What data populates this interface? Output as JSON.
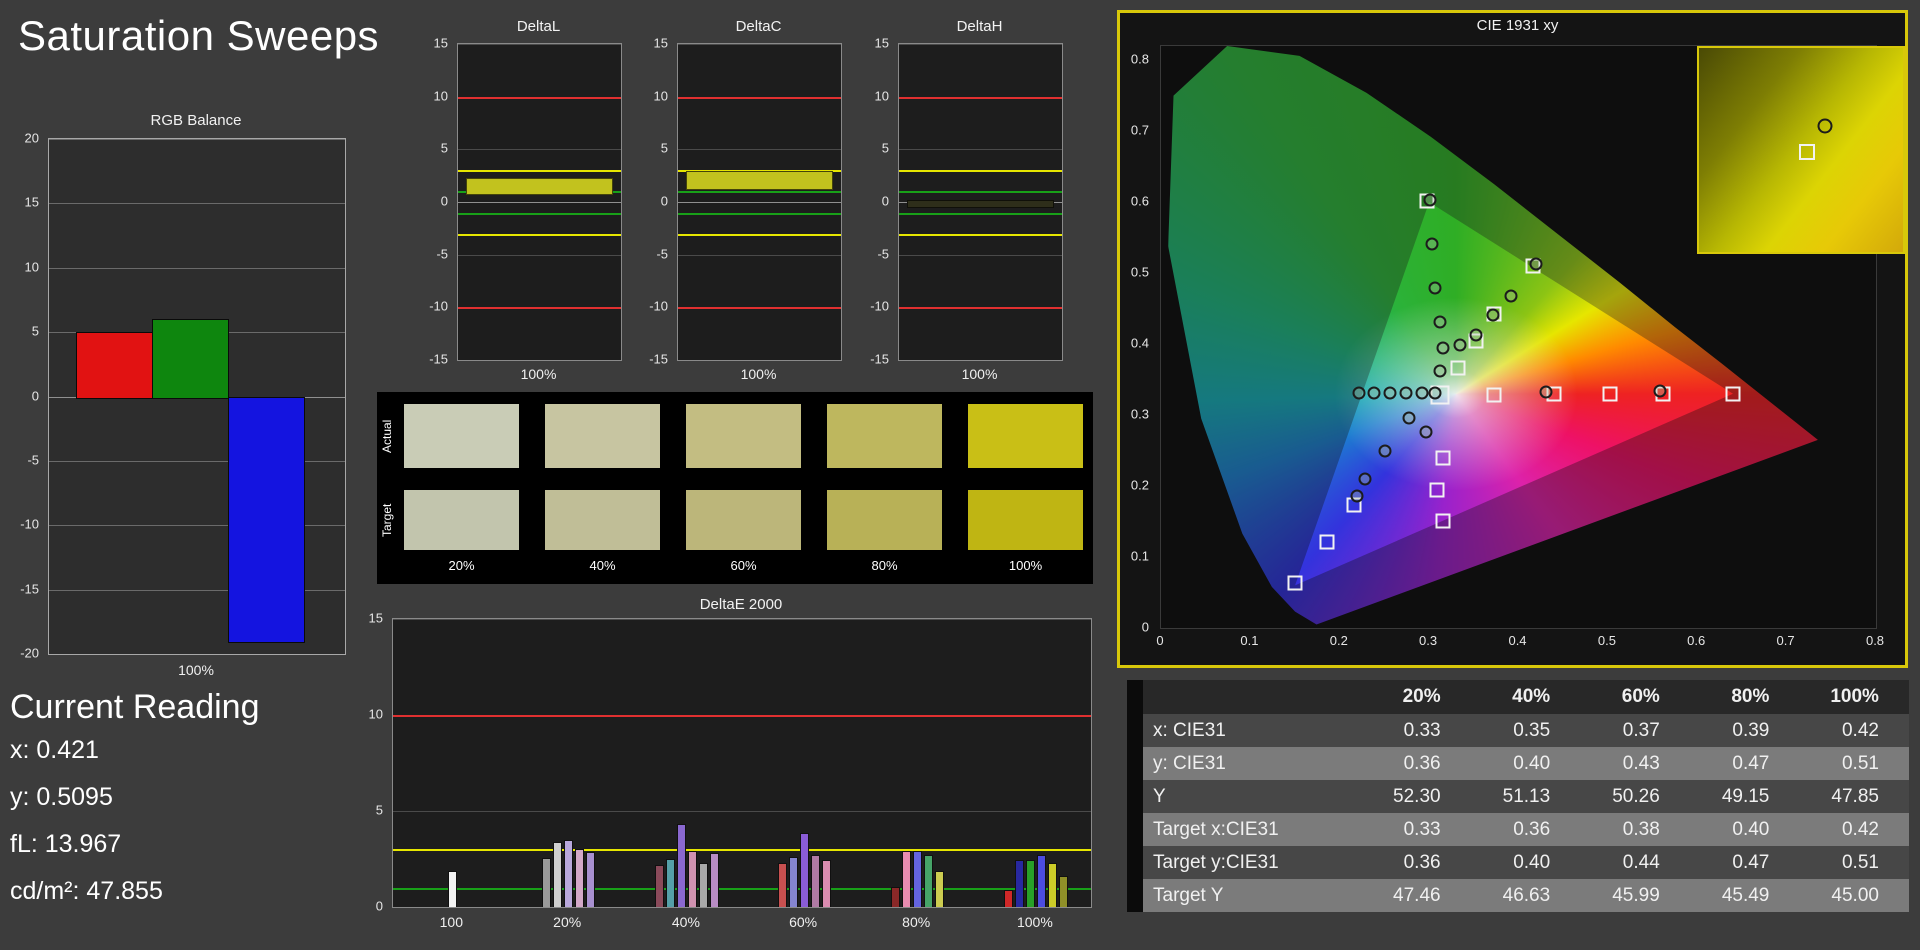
{
  "title": "Saturation Sweeps",
  "current_reading": {
    "heading": "Current Reading",
    "lines": [
      "x: 0.421",
      "y: 0.5095",
      "fL: 13.967",
      "cd/m²: 47.855"
    ]
  },
  "rgb_balance": {
    "title": "RGB Balance",
    "xlabel": "100%",
    "ylim": [
      -20,
      20
    ],
    "yticks": [
      20,
      15,
      10,
      5,
      0,
      -5,
      -10,
      -15,
      -20
    ],
    "bars": [
      {
        "name": "red",
        "color": "#e11212",
        "value": 5
      },
      {
        "name": "green",
        "color": "#0e860e",
        "value": 6
      },
      {
        "name": "blue",
        "color": "#1414e0",
        "value": -19
      }
    ]
  },
  "delta_axis": {
    "ylim": [
      -15,
      15
    ],
    "yticks": [
      15,
      10,
      5,
      0,
      -5,
      -10,
      -15
    ],
    "lines": [
      {
        "value": 10,
        "color": "#e03030"
      },
      {
        "value": 3,
        "color": "#e6e600"
      },
      {
        "value": 1,
        "color": "#18a018"
      },
      {
        "value": -1,
        "color": "#18a018"
      },
      {
        "value": -3,
        "color": "#e6e600"
      },
      {
        "value": -10,
        "color": "#e03030"
      }
    ]
  },
  "delta_charts": [
    {
      "title": "DeltaL",
      "xlabel": "100%",
      "band": {
        "from": 0.9,
        "to": 2.3,
        "color": "#c2c21e"
      }
    },
    {
      "title": "DeltaC",
      "xlabel": "100%",
      "band": {
        "from": 1.3,
        "to": 2.9,
        "color": "#c2c21e"
      }
    },
    {
      "title": "DeltaH",
      "xlabel": "100%",
      "band": {
        "from": -0.35,
        "to": 0.15,
        "color": "#2e2e1a"
      }
    }
  ],
  "swatches": {
    "row_labels": [
      "Actual",
      "Target"
    ],
    "col_labels": [
      "20%",
      "40%",
      "60%",
      "80%",
      "100%"
    ],
    "rows": [
      [
        "#c9ccb6",
        "#c7c5a1",
        "#c3bd82",
        "#beb75e",
        "#c9bf16"
      ],
      [
        "#c2c5ad",
        "#c0be97",
        "#bcb67a",
        "#b8b157",
        "#bfb513"
      ]
    ]
  },
  "deltae_chart": {
    "title": "DeltaE 2000",
    "ylim": [
      0,
      15
    ],
    "yticks": [
      15,
      10,
      5,
      0
    ],
    "lines": [
      {
        "value": 10,
        "color": "#e03030"
      },
      {
        "value": 3,
        "color": "#e6e600"
      },
      {
        "value": 1,
        "color": "#18a018"
      }
    ],
    "groups": [
      {
        "label": "100",
        "bars": [
          {
            "color": "#f2f2f2",
            "value": 1.9
          }
        ]
      },
      {
        "label": "20%",
        "bars": [
          {
            "color": "#9a9a9a",
            "value": 2.55
          },
          {
            "color": "#cfcfcf",
            "value": 3.4
          },
          {
            "color": "#b9a8dc",
            "value": 3.5
          },
          {
            "color": "#d3a8c8",
            "value": 3.0
          },
          {
            "color": "#a890d0",
            "value": 2.85
          }
        ]
      },
      {
        "label": "40%",
        "bars": [
          {
            "color": "#8a4a5a",
            "value": 2.2
          },
          {
            "color": "#55a0a8",
            "value": 2.5
          },
          {
            "color": "#8a68d0",
            "value": 4.3
          },
          {
            "color": "#d092b0",
            "value": 2.9
          },
          {
            "color": "#a8a8a8",
            "value": 2.3
          },
          {
            "color": "#b88cc4",
            "value": 2.8
          }
        ]
      },
      {
        "label": "60%",
        "bars": [
          {
            "color": "#c85050",
            "value": 2.3
          },
          {
            "color": "#8484d0",
            "value": 2.6
          },
          {
            "color": "#8a5cd6",
            "value": 3.85
          },
          {
            "color": "#b07aa4",
            "value": 2.7
          },
          {
            "color": "#da8cb0",
            "value": 2.45
          }
        ]
      },
      {
        "label": "80%",
        "bars": [
          {
            "color": "#8a2828",
            "value": 1.05
          },
          {
            "color": "#e88cb0",
            "value": 2.9
          },
          {
            "color": "#6464e0",
            "value": 2.9
          },
          {
            "color": "#46a468",
            "value": 2.7
          },
          {
            "color": "#cccc50",
            "value": 1.9
          }
        ]
      },
      {
        "label": "100%",
        "bars": [
          {
            "color": "#d02828",
            "value": 0.9
          },
          {
            "color": "#2828a0",
            "value": 2.45
          },
          {
            "color": "#28a028",
            "value": 2.45
          },
          {
            "color": "#4c4ce0",
            "value": 2.7
          },
          {
            "color": "#cccc28",
            "value": 2.3
          },
          {
            "color": "#8f8f28",
            "value": 1.6
          }
        ]
      }
    ]
  },
  "cie": {
    "title": "CIE 1931 xy",
    "xticks": [
      0,
      0.1,
      0.2,
      0.3,
      0.4,
      0.5,
      0.6,
      0.7,
      0.8
    ],
    "yticks": [
      0,
      0.1,
      0.2,
      0.3,
      0.4,
      0.5,
      0.6,
      0.7,
      0.8
    ],
    "white_point": [
      0.312,
      0.328
    ],
    "squares": [
      [
        0.298,
        0.601
      ],
      [
        0.416,
        0.51
      ],
      [
        0.372,
        0.443
      ],
      [
        0.352,
        0.405
      ],
      [
        0.332,
        0.366
      ],
      [
        0.372,
        0.329
      ],
      [
        0.44,
        0.33
      ],
      [
        0.502,
        0.33
      ],
      [
        0.562,
        0.33
      ],
      [
        0.64,
        0.33
      ],
      [
        0.316,
        0.24
      ],
      [
        0.309,
        0.195
      ],
      [
        0.316,
        0.151
      ],
      [
        0.216,
        0.174
      ],
      [
        0.186,
        0.121
      ],
      [
        0.15,
        0.063
      ]
    ],
    "circles": [
      [
        0.301,
        0.603
      ],
      [
        0.303,
        0.541
      ],
      [
        0.306,
        0.479
      ],
      [
        0.312,
        0.431
      ],
      [
        0.316,
        0.394
      ],
      [
        0.334,
        0.399
      ],
      [
        0.352,
        0.413
      ],
      [
        0.371,
        0.441
      ],
      [
        0.392,
        0.468
      ],
      [
        0.419,
        0.513
      ],
      [
        0.221,
        0.331
      ],
      [
        0.238,
        0.331
      ],
      [
        0.256,
        0.331
      ],
      [
        0.274,
        0.331
      ],
      [
        0.292,
        0.331
      ],
      [
        0.306,
        0.331
      ],
      [
        0.431,
        0.333
      ],
      [
        0.558,
        0.334
      ],
      [
        0.277,
        0.296
      ],
      [
        0.296,
        0.276
      ],
      [
        0.251,
        0.25
      ],
      [
        0.228,
        0.21
      ],
      [
        0.219,
        0.186
      ],
      [
        0.312,
        0.362
      ]
    ],
    "inset": {
      "circle": [
        0.62,
        0.38
      ],
      "square": [
        0.53,
        0.51
      ]
    }
  },
  "table": {
    "header": [
      "20%",
      "40%",
      "60%",
      "80%",
      "100%"
    ],
    "rows": [
      {
        "label": "x: CIE31",
        "values": [
          "0.33",
          "0.35",
          "0.37",
          "0.39",
          "0.42"
        ]
      },
      {
        "label": "y: CIE31",
        "values": [
          "0.36",
          "0.40",
          "0.43",
          "0.47",
          "0.51"
        ]
      },
      {
        "label": "Y",
        "values": [
          "52.30",
          "51.13",
          "50.26",
          "49.15",
          "47.85"
        ]
      },
      {
        "label": "Target x:CIE31",
        "values": [
          "0.33",
          "0.36",
          "0.38",
          "0.40",
          "0.42"
        ]
      },
      {
        "label": "Target y:CIE31",
        "values": [
          "0.36",
          "0.40",
          "0.44",
          "0.47",
          "0.51"
        ]
      },
      {
        "label": "Target Y",
        "values": [
          "47.46",
          "46.63",
          "45.99",
          "45.49",
          "45.00"
        ]
      }
    ]
  }
}
